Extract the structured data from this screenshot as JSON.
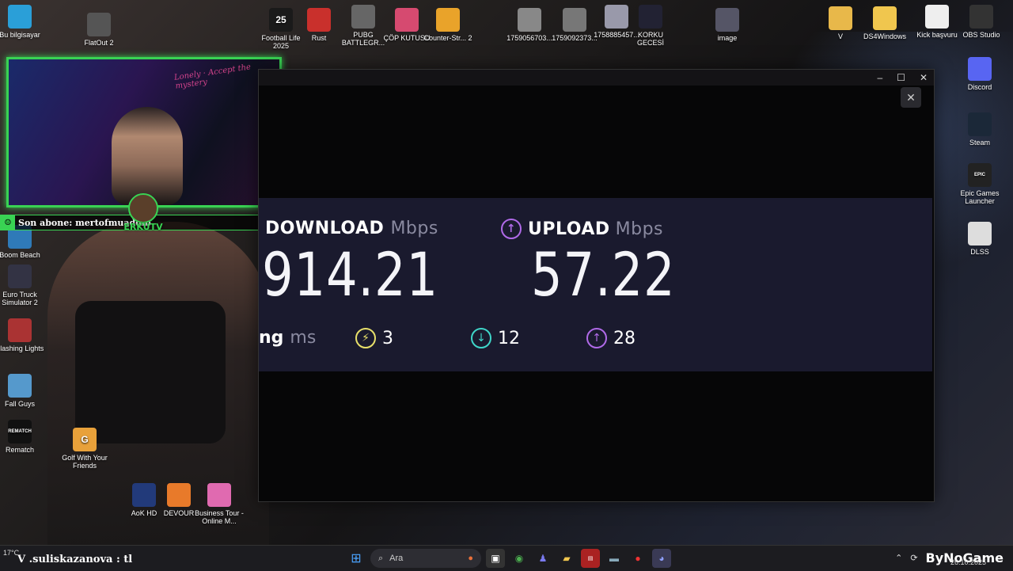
{
  "desktop": {
    "icons_top": [
      {
        "label": "Bu bilgisayar",
        "icon": "computer-icon",
        "color": "#2a9fd8"
      },
      {
        "label": "FlatOut 2",
        "icon": "flatout-icon",
        "color": "#555"
      },
      {
        "label": "Football Life 2025",
        "icon": "football-life-icon",
        "color": "#1a1a1a",
        "glyph": "25"
      },
      {
        "label": "Rust",
        "icon": "rust-icon",
        "color": "#c9302c"
      },
      {
        "label": "PUBG BATTLEGR...",
        "icon": "pubg-icon",
        "color": "#666"
      },
      {
        "label": "ÇÖP KUTUSU",
        "icon": "recycle-bin-icon",
        "color": "#d64a70"
      },
      {
        "label": "Counter-Str... 2",
        "icon": "cs2-icon",
        "color": "#e9a32a"
      },
      {
        "label": "1759056703...",
        "icon": "image-file-icon",
        "color": "#888"
      },
      {
        "label": "1759092373...",
        "icon": "image-file-icon",
        "color": "#777"
      },
      {
        "label": "1758885457...",
        "icon": "image-file-icon",
        "color": "#99a"
      },
      {
        "label": "KORKU GECESİ",
        "icon": "image-file-icon",
        "color": "#223"
      },
      {
        "label": "image",
        "icon": "image-file-icon",
        "color": "#556"
      },
      {
        "label": "V",
        "icon": "folder-icon",
        "color": "#e8b84a"
      },
      {
        "label": "DS4Windows",
        "icon": "folder-icon",
        "color": "#f0c64e"
      },
      {
        "label": "Kick başvuru",
        "icon": "document-icon",
        "color": "#eee"
      },
      {
        "label": "OBS Studio",
        "icon": "obs-icon",
        "color": "#333"
      }
    ],
    "icons_right": [
      {
        "label": "Discord",
        "icon": "discord-icon",
        "color": "#5865f2"
      },
      {
        "label": "Steam",
        "icon": "steam-icon",
        "color": "#1b2838"
      },
      {
        "label": "Epic Games Launcher",
        "icon": "epic-games-icon",
        "color": "#222",
        "glyph": "EPIC"
      },
      {
        "label": "DLSS",
        "icon": "file-icon",
        "color": "#ddd"
      }
    ],
    "icons_left": [
      {
        "label": "Boom Beach",
        "icon": "boom-beach-icon",
        "color": "#2f7ab8"
      },
      {
        "label": "Euro Truck Simulator 2",
        "icon": "ets2-icon",
        "color": "#334"
      },
      {
        "label": "Flashing Lights",
        "icon": "flashing-lights-icon",
        "color": "#a33"
      },
      {
        "label": "Fall Guys",
        "icon": "fall-guys-icon",
        "color": "#59c"
      },
      {
        "label": "Rematch",
        "icon": "rematch-icon",
        "color": "#111",
        "glyph": "REMATCH"
      },
      {
        "label": "Golf With Your Friends",
        "icon": "golf-icon",
        "color": "#e8a13a",
        "glyph": "G"
      },
      {
        "label": "AoK HD",
        "icon": "aok-icon",
        "color": "#223a7a"
      },
      {
        "label": "DEVOUR",
        "icon": "devour-icon",
        "color": "#e87a2a"
      },
      {
        "label": "Business Tour - Online M...",
        "icon": "business-tour-icon",
        "color": "#e06ab0"
      }
    ]
  },
  "stream": {
    "sub_text": "Son abone: mertofmuaddib",
    "channel_logo": "ERKUTV"
  },
  "speedtest": {
    "download_label": "DOWNLOAD",
    "download_unit": "Mbps",
    "download_value": "914.21",
    "upload_label": "UPLOAD",
    "upload_unit": "Mbps",
    "upload_value": "57.22",
    "ping_label": "ng",
    "ping_unit": "ms",
    "ping_idle": "3",
    "ping_download": "12",
    "ping_upload": "28",
    "colors": {
      "idle": "#e8e06a",
      "download": "#3fd6c9",
      "upload": "#b06ae8",
      "background": "#1a1a2e"
    }
  },
  "window": {
    "close_glyph": "✕",
    "title_minimize": "–",
    "title_maximize": "☐",
    "title_close": "✕"
  },
  "taskbar": {
    "weather": "17°C",
    "chat_overlay": "V .suliskazanova : tl",
    "search_placeholder": "Ara",
    "brand": "ByNoGame",
    "date": "26.10.2025"
  }
}
